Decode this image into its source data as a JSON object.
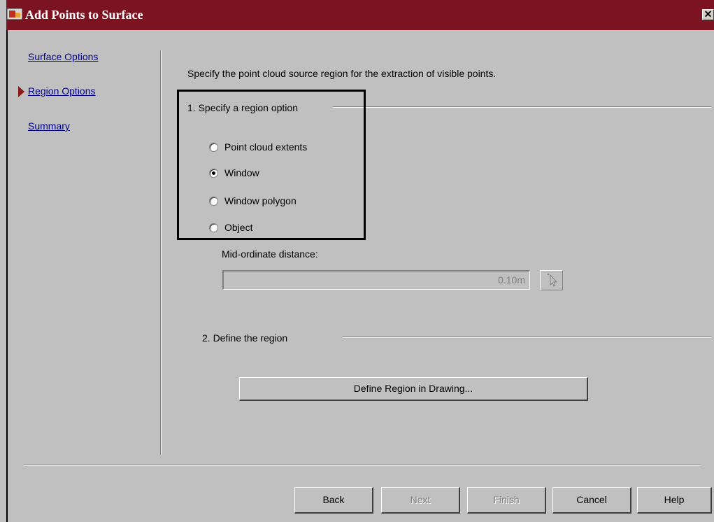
{
  "window": {
    "title": "Add Points to Surface",
    "close_glyph": "✕",
    "app_icon": "autodesk-app-icon"
  },
  "nav": {
    "items": [
      {
        "label": "Surface Options",
        "active": false
      },
      {
        "label": "Region Options",
        "active": true
      },
      {
        "label": "Summary",
        "active": false
      }
    ]
  },
  "main": {
    "instruction": "Specify the point cloud source region for the extraction of visible points.",
    "section1_title": "1. Specify a region option",
    "radio_options": [
      {
        "label": "Point cloud extents",
        "checked": false
      },
      {
        "label": "Window",
        "checked": true
      },
      {
        "label": "Window polygon",
        "checked": false
      },
      {
        "label": "Object",
        "checked": false
      }
    ],
    "midordinate_label": "Mid-ordinate distance:",
    "midordinate_value": "0.10m",
    "section2_title": "2. Define the region",
    "define_region_button": "Define Region in Drawing..."
  },
  "footer": {
    "back": "Back",
    "next": "Next",
    "finish": "Finish",
    "cancel": "Cancel",
    "help": "Help"
  },
  "colors": {
    "titlebar": "#7b1320",
    "dialog_bg": "#c0c0c0",
    "link": "#00008b",
    "active_arrow": "#8b1a1a"
  }
}
